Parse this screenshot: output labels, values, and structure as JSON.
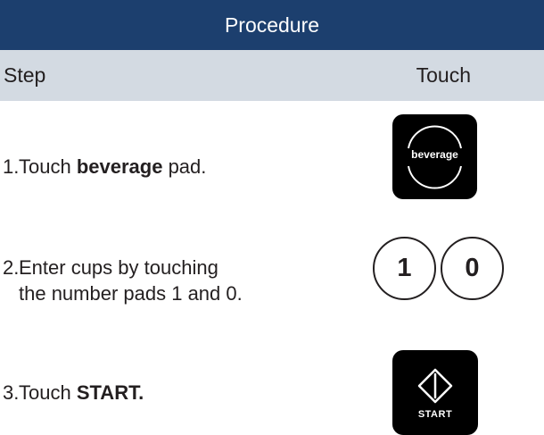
{
  "header": {
    "title": "Procedure"
  },
  "columns": {
    "step": "Step",
    "touch": "Touch"
  },
  "steps": [
    {
      "number": "1.",
      "text_before": "Touch ",
      "bold": "beverage",
      "text_after": " pad."
    },
    {
      "number": "2.",
      "line1": "Enter cups by touching",
      "line2": "the number pads 1 and 0."
    },
    {
      "number": "3.",
      "text_before": "Touch ",
      "bold": "START."
    }
  ],
  "pads": {
    "beverage_label": "beverage",
    "digit_1": "1",
    "digit_0": "0",
    "start_label": "START"
  },
  "colors": {
    "header_bg": "#1c3f6e",
    "subheader_bg": "#d3dae2",
    "text": "#231f20",
    "pad_bg": "#000000"
  }
}
